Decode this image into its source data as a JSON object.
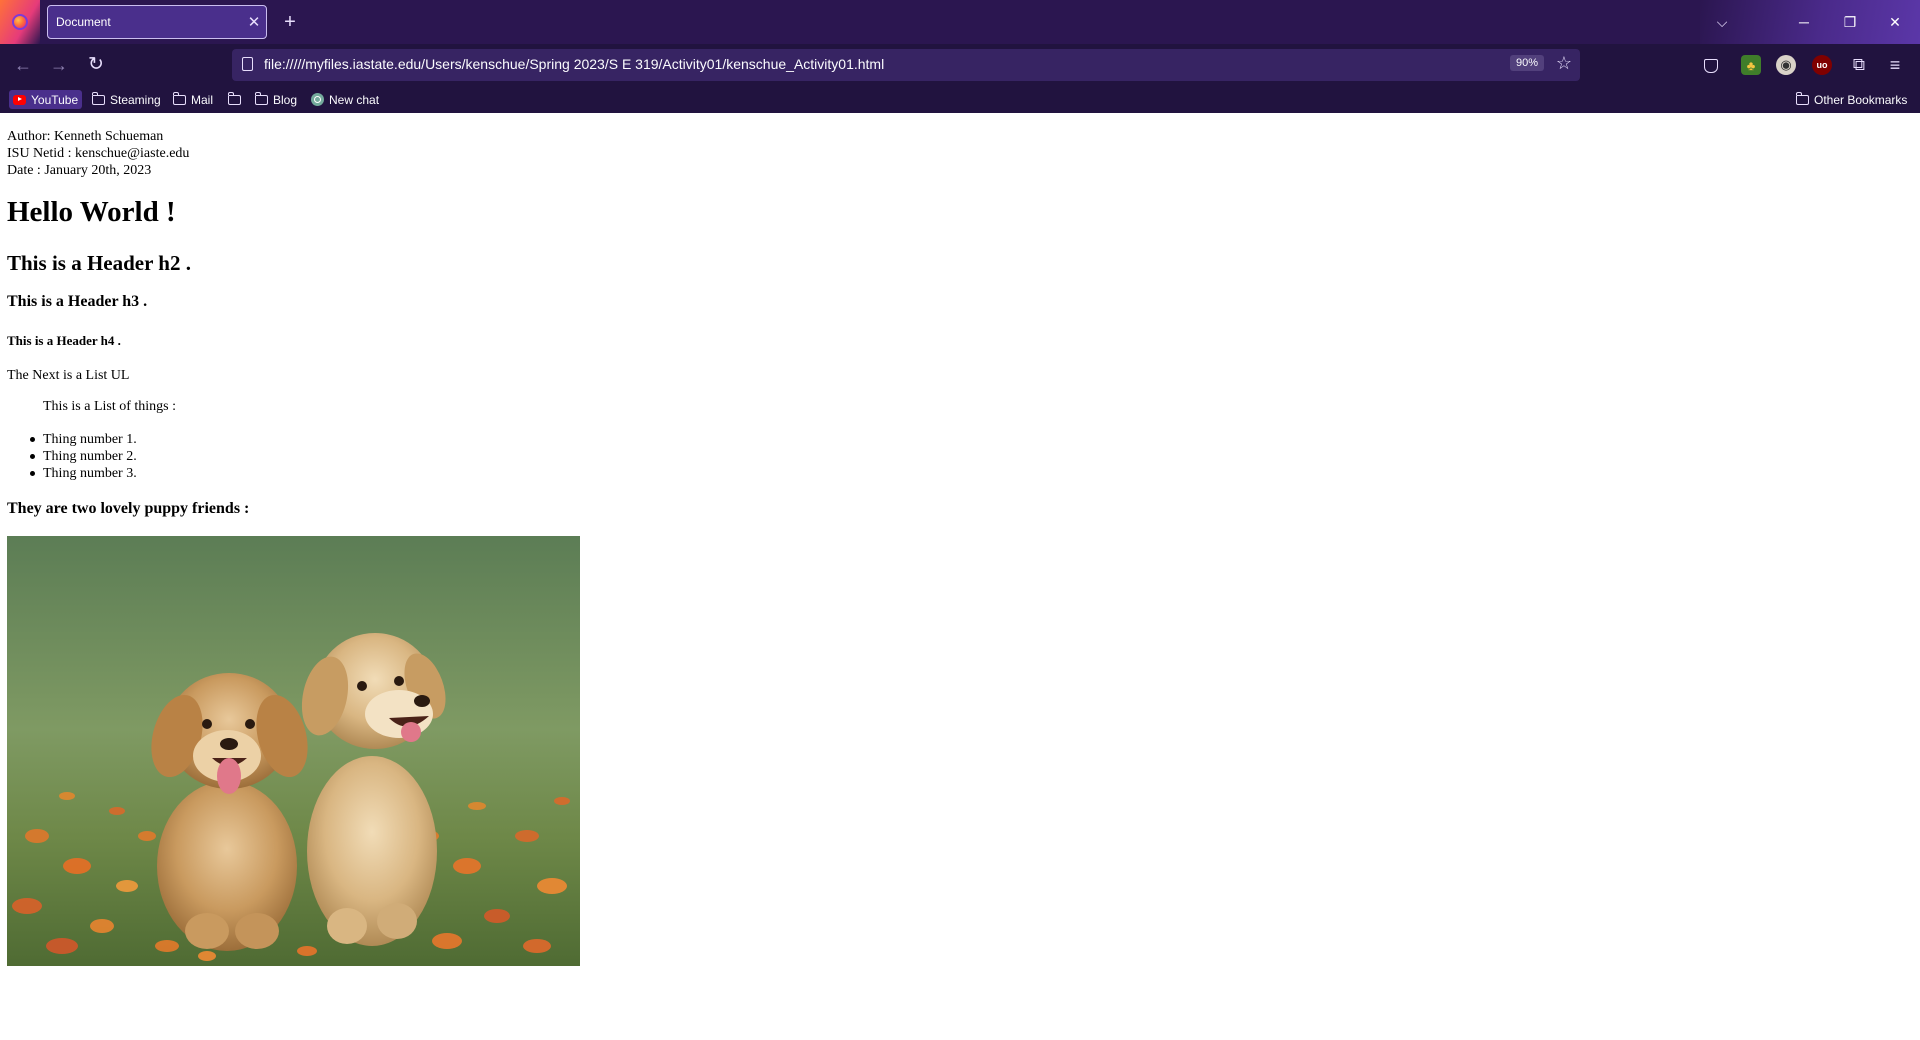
{
  "browser": {
    "tab_title": "Document",
    "url": "file://///myfiles.iastate.edu/Users/kenschue/Spring 2023/S E 319/Activity01/kenschue_Activity01.html",
    "zoom": "90%",
    "bookmarks": [
      {
        "label": "YouTube",
        "icon": "youtube-icon"
      },
      {
        "label": "Steaming",
        "icon": "folder-icon"
      },
      {
        "label": "Mail",
        "icon": "folder-icon"
      },
      {
        "label": "",
        "icon": "folder-icon"
      },
      {
        "label": "Blog",
        "icon": "folder-icon"
      },
      {
        "label": "New chat",
        "icon": "chatgpt-icon"
      }
    ],
    "other_bookmarks": "Other Bookmarks",
    "colors": {
      "frame": "#21133f",
      "tab_strip": "#2b1650",
      "active_tab": "#4a2f8c",
      "url_field": "#372463"
    }
  },
  "page": {
    "meta": {
      "author": "Author: Kenneth Schueman",
      "netid": "ISU Netid : kenschue@iaste.edu",
      "date": "Date : January 20th, 2023"
    },
    "h1": "Hello World !",
    "h2": "This is a Header h2 .",
    "h3": "This is a Header h3 .",
    "h4": "This is a Header h4 .",
    "list_intro": "The Next is a List UL",
    "list_caption": "This is a List of things :",
    "list_items": [
      "Thing number 1.",
      "Thing number 2.",
      "Thing number 3."
    ],
    "puppy_heading": "They are two lovely puppy friends :"
  }
}
